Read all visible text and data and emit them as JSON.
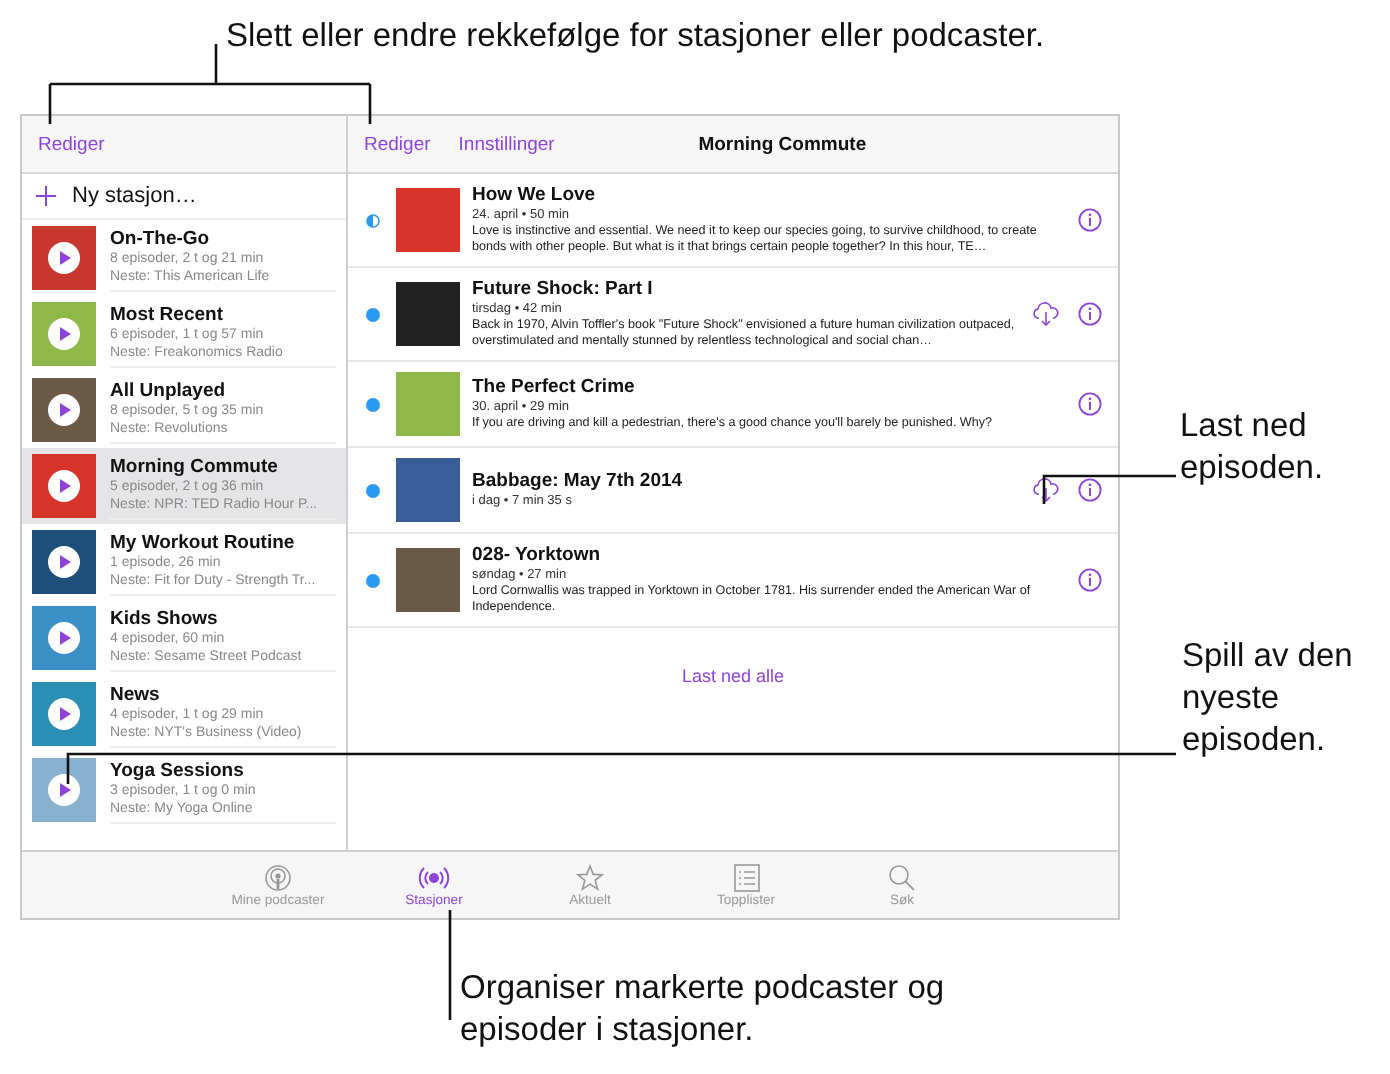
{
  "callouts": [
    {
      "kind": "top",
      "text": "Slett eller endre rekkefølge for stasjoner eller podcaster."
    },
    {
      "kind": "download",
      "text": "Last ned episoden."
    },
    {
      "kind": "play",
      "text": "Spill av den nyeste episoden."
    },
    {
      "kind": "bottom",
      "text": "Organiser markerte podcaster og episoder i stasjoner."
    }
  ],
  "sidebar": {
    "edit": "Rediger",
    "new_station": "Ny stasjon…",
    "items": [
      {
        "title": "On-The-Go",
        "meta": "8 episoder, 2 t og 21 min",
        "next": "Neste: This American Life",
        "color": "#c8372d",
        "selected": false
      },
      {
        "title": "Most Recent",
        "meta": "6 episoder, 1 t og 57 min",
        "next": "Neste: Freakonomics Radio",
        "color": "#8fb84a",
        "selected": false
      },
      {
        "title": "All Unplayed",
        "meta": "8 episoder, 5 t og 35 min",
        "next": "Neste: Revolutions",
        "color": "#6b5a45",
        "selected": false
      },
      {
        "title": "Morning Commute",
        "meta": "5 episoder, 2 t og 36 min",
        "next": "Neste: NPR: TED Radio Hour P...",
        "color": "#d9342b",
        "selected": true
      },
      {
        "title": "My Workout Routine",
        "meta": "1 episode, 26 min",
        "next": "Neste: Fit for Duty - Strength Tr...",
        "color": "#1d4f7a",
        "selected": false
      },
      {
        "title": "Kids Shows",
        "meta": "4 episoder, 60 min",
        "next": "Neste: Sesame Street Podcast",
        "color": "#3b8fc7",
        "selected": false
      },
      {
        "title": "News",
        "meta": "4 episoder, 1 t og 29 min",
        "next": "Neste: NYT's Business (Video)",
        "color": "#2a8fb5",
        "selected": false
      },
      {
        "title": "Yoga Sessions",
        "meta": "3 episoder, 1 t og 0 min",
        "next": "Neste: My Yoga Online",
        "color": "#8ab0cf",
        "selected": false
      }
    ]
  },
  "station": {
    "edit": "Rediger",
    "settings": "Innstillinger",
    "title": "Morning Commute",
    "download_all": "Last ned alle",
    "episodes": [
      {
        "title": "How We Love",
        "meta": "24. april • 50 min",
        "description": "Love is instinctive and essential. We need it to keep our species going, to survive childhood, to create bonds with other people. But what is it that brings certain people together?  In this hour, TE…",
        "kind": "partial",
        "downloadable": false,
        "color": "#d9342b"
      },
      {
        "title": "Future Shock: Part I",
        "meta": "tirsdag • 42 min",
        "description": "Back in 1970, Alvin Toffler's book \"Future Shock\" envisioned a future human civilization outpaced, overstimulated and mentally stunned by relentless technological and social chan…",
        "kind": "unplayed",
        "downloadable": true,
        "color": "#222222"
      },
      {
        "title": "The Perfect Crime",
        "meta": "30. april • 29 min",
        "description": "If you are driving and kill a pedestrian, there's a good chance you'll barely be punished. Why?",
        "kind": "unplayed",
        "downloadable": false,
        "color": "#8fb84a"
      },
      {
        "title": "Babbage: May 7th 2014",
        "meta": "i dag • 7 min 35 s",
        "kind": "unplayed",
        "downloadable": true,
        "color": "#3a5d9a"
      },
      {
        "title": "028- Yorktown",
        "meta": "søndag • 27 min",
        "description": "Lord Cornwallis was trapped in Yorktown in October 1781. His surrender ended the American War of Independence.",
        "kind": "unplayed",
        "downloadable": false,
        "color": "#6b5a45"
      }
    ]
  },
  "tab_bar": [
    {
      "label": "Mine podcaster",
      "kind": "podcast",
      "selected": false
    },
    {
      "label": "Stasjoner",
      "kind": "station",
      "selected": true
    },
    {
      "label": "Aktuelt",
      "kind": "star",
      "selected": false
    },
    {
      "label": "Topplister",
      "kind": "list",
      "selected": false
    },
    {
      "label": "Søk",
      "kind": "search",
      "selected": false
    }
  ]
}
